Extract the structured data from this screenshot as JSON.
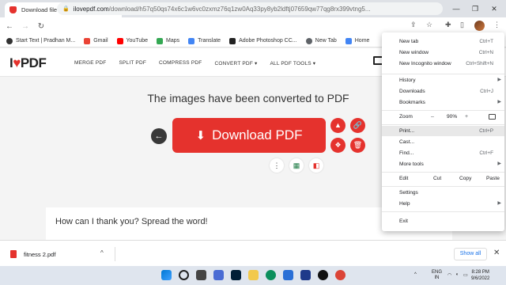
{
  "browser": {
    "tab_title": "Download file | iLovePDF",
    "url_domain": "ilovepdf.com",
    "url_path": "/download/h57q50qs74x6c1w6vc0zxmz76q1zw0Aq33py8yb2ldftj07659qw77qg8rx399vtng5...",
    "new_tab_symbol": "+",
    "tab_close_symbol": "✕"
  },
  "bookmarks": [
    {
      "label": "Start Text | Pradhan M...",
      "color": "#333333"
    },
    {
      "label": "Gmail",
      "color": "#ea4335"
    },
    {
      "label": "YouTube",
      "color": "#ff0000"
    },
    {
      "label": "Maps",
      "color": "#34a853"
    },
    {
      "label": "Translate",
      "color": "#4285f4"
    },
    {
      "label": "Adobe Photoshop CC...",
      "color": "#222222"
    },
    {
      "label": "New Tab",
      "color": "#5f6368"
    },
    {
      "label": "Home",
      "color": "#4285f4"
    }
  ],
  "site": {
    "logo_pre": "I",
    "logo_heart": "♥",
    "logo_post": "PDF",
    "nav": [
      "MERGE PDF",
      "SPLIT PDF",
      "COMPRESS PDF",
      "CONVERT PDF ▾",
      "ALL PDF TOOLS ▾"
    ],
    "heading": "The images have been converted to PDF",
    "download_label": "Download PDF",
    "thank_heading": "How can I thank you? Spread the word!"
  },
  "menu": {
    "new_tab": "New tab",
    "new_tab_sc": "Ctrl+T",
    "new_window": "New window",
    "new_window_sc": "Ctrl+N",
    "new_incognito": "New Incognito window",
    "new_incognito_sc": "Ctrl+Shift+N",
    "history": "History",
    "downloads": "Downloads",
    "downloads_sc": "Ctrl+J",
    "bookmarks": "Bookmarks",
    "zoom": "Zoom",
    "zoom_minus": "–",
    "zoom_value": "90%",
    "zoom_plus": "+",
    "print": "Print...",
    "print_sc": "Ctrl+P",
    "cast": "Cast...",
    "find": "Find...",
    "find_sc": "Ctrl+F",
    "more_tools": "More tools",
    "edit": "Edit",
    "cut": "Cut",
    "copy": "Copy",
    "paste": "Paste",
    "settings": "Settings",
    "help": "Help",
    "exit": "Exit"
  },
  "downloads_shelf": {
    "filename": "fitness 2.pdf",
    "show_all": "Show all"
  },
  "taskbar": {
    "lang_top": "ENG",
    "lang_bottom": "IN",
    "time": "8:28 PM",
    "date": "9/6/2022"
  }
}
